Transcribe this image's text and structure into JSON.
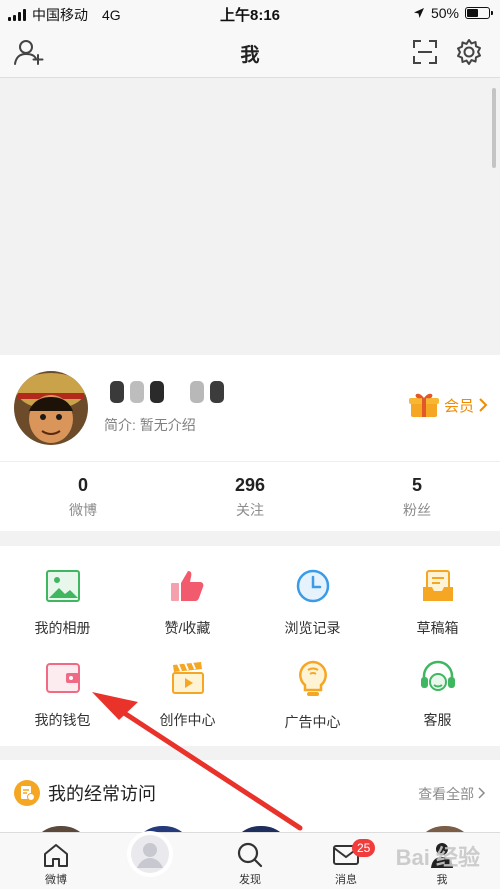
{
  "status_bar": {
    "carrier": "中国移动",
    "network": "4G",
    "time": "上午8:16",
    "battery": "50%",
    "battery_level": 0.5
  },
  "nav": {
    "title": "我",
    "left_icon": "add-friend-icon",
    "right_icons": [
      "scan-icon",
      "settings-icon"
    ]
  },
  "profile": {
    "bio": "简介: 暂无介绍",
    "vip_label": "会员",
    "stats": [
      {
        "value": "0",
        "label": "微博"
      },
      {
        "value": "296",
        "label": "关注"
      },
      {
        "value": "5",
        "label": "粉丝"
      }
    ]
  },
  "grid": [
    {
      "label": "我的相册",
      "icon": "album-icon"
    },
    {
      "label": "赞/收藏",
      "icon": "like-icon"
    },
    {
      "label": "浏览记录",
      "icon": "history-icon"
    },
    {
      "label": "草稿箱",
      "icon": "drafts-icon"
    },
    {
      "label": "我的钱包",
      "icon": "wallet-icon"
    },
    {
      "label": "创作中心",
      "icon": "creator-icon"
    },
    {
      "label": "广告中心",
      "icon": "ads-icon"
    },
    {
      "label": "客服",
      "icon": "support-icon"
    }
  ],
  "frequent": {
    "title": "我的经常访问",
    "more": "查看全部"
  },
  "tabs": [
    {
      "label": "微博",
      "icon": "home-icon"
    },
    {
      "label": "",
      "icon": "compose-icon"
    },
    {
      "label": "发现",
      "icon": "search-icon"
    },
    {
      "label": "消息",
      "icon": "message-icon",
      "badge": "25"
    },
    {
      "label": "我",
      "icon": "profile-icon"
    }
  ],
  "watermark": "Bai 经验",
  "colors": {
    "accent": "#f08c00",
    "badge": "#f23b3b",
    "annotation_arrow": "#e8322a"
  }
}
